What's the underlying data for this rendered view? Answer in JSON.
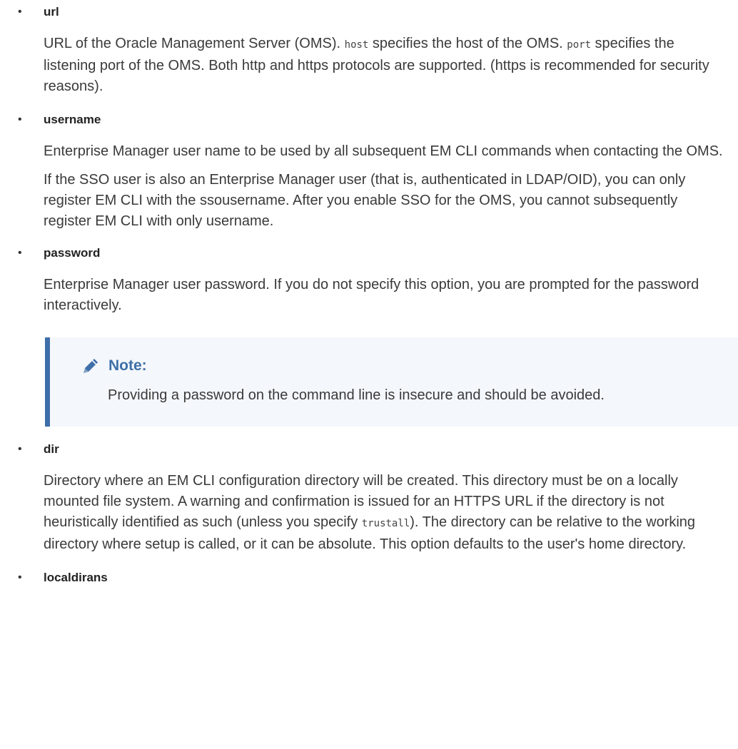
{
  "items": [
    {
      "term": "url",
      "paragraphs": [
        {
          "parts": [
            {
              "t": "URL of the Oracle Management Server (OMS). "
            },
            {
              "c": "host"
            },
            {
              "t": " specifies the host of the OMS. "
            },
            {
              "c": "port"
            },
            {
              "t": " specifies the listening port of the OMS. Both http and https protocols are supported. (https is recommended for security reasons)."
            }
          ]
        }
      ]
    },
    {
      "term": "username",
      "paragraphs": [
        {
          "text": "Enterprise Manager user name to be used by all subsequent EM CLI commands when contacting the OMS."
        },
        {
          "text": "If the SSO user is also an Enterprise Manager user (that is, authenticated in LDAP/OID), you can only register EM CLI with the ssousername. After you enable SSO for the OMS, you cannot subsequently register EM CLI with only username."
        }
      ]
    },
    {
      "term": "password",
      "paragraphs": [
        {
          "text": "Enterprise Manager user password. If you do not specify this option, you are prompted for the password interactively."
        }
      ]
    },
    {
      "term": "dir",
      "paragraphs": [
        {
          "parts": [
            {
              "t": "Directory where an EM CLI configuration directory will be created. This directory must be on a locally mounted file system. A warning and confirmation is issued for an HTTPS URL if the directory is not heuristically identified as such (unless you specify "
            },
            {
              "c": "trustall"
            },
            {
              "t": "). The directory can be relative to the working directory where setup is called, or it can be absolute. This option defaults to the user's home directory."
            }
          ]
        }
      ]
    },
    {
      "term": "localdirans",
      "paragraphs": []
    }
  ],
  "bullet": "•",
  "note": {
    "icon": "pencil-icon",
    "title": "Note:",
    "body": "Providing a password on the command line is insecure and should be avoided."
  },
  "colors": {
    "note_accent": "#3e6fa8",
    "note_background": "#f4f7fb",
    "text": "#333333"
  }
}
